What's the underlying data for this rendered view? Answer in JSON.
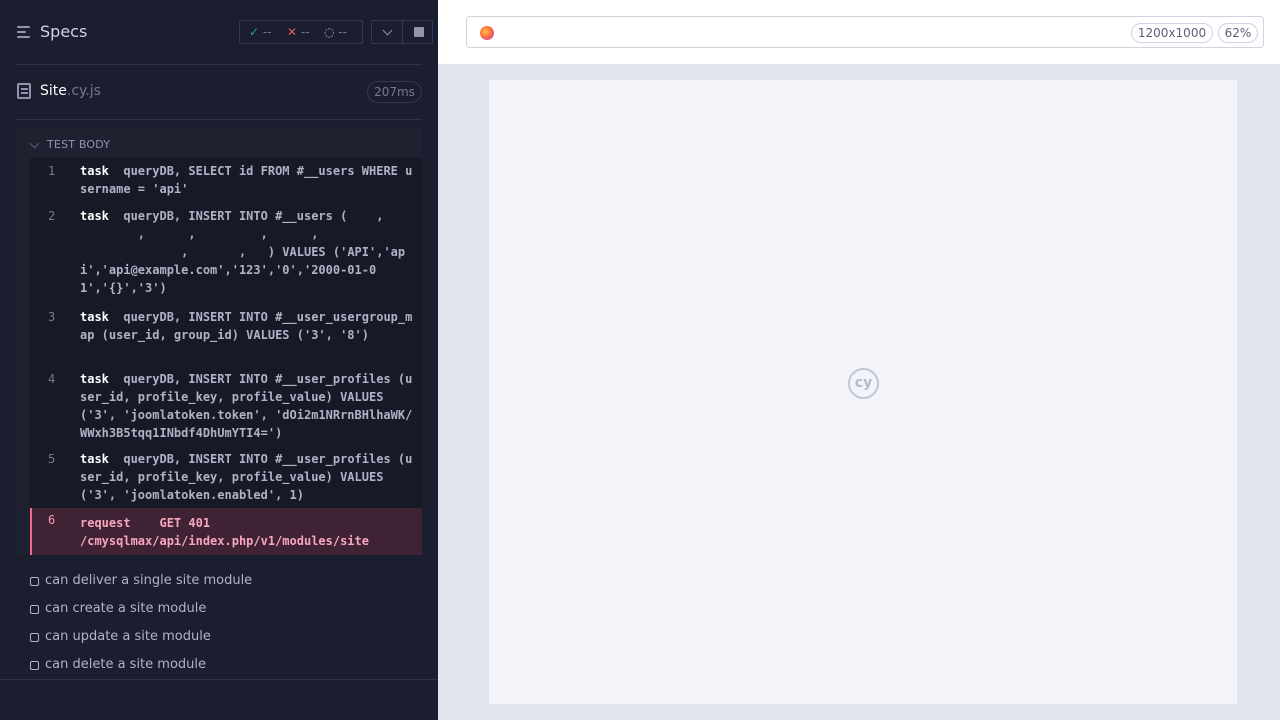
{
  "reporter": {
    "title": "Specs",
    "stats": {
      "passed": "--",
      "failed": "--",
      "pending": "--"
    },
    "spec": {
      "name": "Site",
      "ext": ".cy.js",
      "duration": "207ms"
    },
    "section_label": "TEST BODY",
    "commands": [
      {
        "num": "1",
        "name": "task",
        "message": "queryDB, SELECT id FROM #__users WHERE username = 'api'"
      },
      {
        "num": "2",
        "name": "task",
        "message": "queryDB, INSERT INTO #__users (    ,\n        ,      ,         ,      ,\n              ,       ,   ) VALUES ('API','api','api@example.com','123','0','2000-01-01','{}','3')"
      },
      {
        "num": "3",
        "name": "task",
        "message": "queryDB, INSERT INTO #__user_usergroup_map (user_id, group_id) VALUES ('3', '8')"
      },
      {
        "num": "4",
        "name": "task",
        "message": "queryDB, INSERT INTO #__user_profiles (user_id, profile_key, profile_value) VALUES ('3', 'joomlatoken.token', 'dOi2m1NRrnBHlhaWK/WWxh3B5tqq1INbdf4DhUmYTI4=')"
      },
      {
        "num": "5",
        "name": "task",
        "message": "queryDB, INSERT INTO #__user_profiles (user_id, profile_key, profile_value) VALUES ('3', 'joomlatoken.enabled', 1)"
      }
    ],
    "error_command": {
      "num": "6",
      "name": "request",
      "message": "GET 401 /cmysqlmax/api/index.php/v1/modules/site"
    },
    "tests": [
      "can deliver a single site module",
      "can create a site module",
      "can update a site module",
      "can delete a site module"
    ]
  },
  "aut": {
    "viewport_size": "1200x1000",
    "zoom": "62%",
    "logo_text": "cy"
  },
  "colors": {
    "reporter_bg": "#1b1e2e",
    "error_accent": "#f06b8a",
    "aut_bg": "#e1e3ed"
  },
  "icons": [
    "specs-menu-icon",
    "check-icon",
    "x-icon",
    "spinner-icon",
    "chevron-down-icon",
    "stop-icon",
    "file-icon",
    "firefox-icon",
    "cypress-logo-icon"
  ]
}
